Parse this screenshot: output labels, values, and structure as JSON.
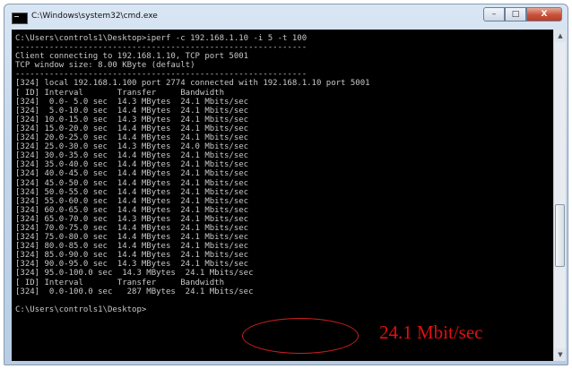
{
  "window": {
    "title": "C:\\Windows\\system32\\cmd.exe"
  },
  "controls": {
    "min": "–",
    "max": "□",
    "close": "X"
  },
  "scroll": {
    "up": "▲",
    "down": "▼"
  },
  "console": {
    "lines": [
      "C:\\Users\\controls1\\Desktop>iperf -c 192.168.1.10 -i 5 -t 100",
      "------------------------------------------------------------",
      "Client connecting to 192.168.1.10, TCP port 5001",
      "TCP window size: 8.00 KByte (default)",
      "------------------------------------------------------------",
      "[324] local 192.168.1.100 port 2774 connected with 192.168.1.10 port 5001",
      "[ ID] Interval       Transfer     Bandwidth",
      "[324]  0.0- 5.0 sec  14.3 MBytes  24.1 Mbits/sec",
      "[324]  5.0-10.0 sec  14.4 MBytes  24.1 Mbits/sec",
      "[324] 10.0-15.0 sec  14.3 MBytes  24.1 Mbits/sec",
      "[324] 15.0-20.0 sec  14.4 MBytes  24.1 Mbits/sec",
      "[324] 20.0-25.0 sec  14.4 MBytes  24.1 Mbits/sec",
      "[324] 25.0-30.0 sec  14.3 MBytes  24.0 Mbits/sec",
      "[324] 30.0-35.0 sec  14.4 MBytes  24.1 Mbits/sec",
      "[324] 35.0-40.0 sec  14.4 MBytes  24.1 Mbits/sec",
      "[324] 40.0-45.0 sec  14.4 MBytes  24.1 Mbits/sec",
      "[324] 45.0-50.0 sec  14.4 MBytes  24.1 Mbits/sec",
      "[324] 50.0-55.0 sec  14.4 MBytes  24.1 Mbits/sec",
      "[324] 55.0-60.0 sec  14.4 MBytes  24.1 Mbits/sec",
      "[324] 60.0-65.0 sec  14.4 MBytes  24.1 Mbits/sec",
      "[324] 65.0-70.0 sec  14.3 MBytes  24.1 Mbits/sec",
      "[324] 70.0-75.0 sec  14.4 MBytes  24.1 Mbits/sec",
      "[324] 75.0-80.0 sec  14.4 MBytes  24.1 Mbits/sec",
      "[324] 80.0-85.0 sec  14.4 MBytes  24.1 Mbits/sec",
      "[324] 85.0-90.0 sec  14.4 MBytes  24.1 Mbits/sec",
      "[324] 90.0-95.0 sec  14.3 MBytes  24.1 Mbits/sec",
      "[324] 95.0-100.0 sec  14.3 MBytes  24.1 Mbits/sec",
      "[ ID] Interval       Transfer     Bandwidth",
      "[324]  0.0-100.0 sec   287 MBytes  24.1 Mbits/sec",
      "",
      "C:\\Users\\controls1\\Desktop>"
    ]
  },
  "annotation": {
    "text": "24.1 Mbit/sec",
    "color": "#e01010"
  }
}
